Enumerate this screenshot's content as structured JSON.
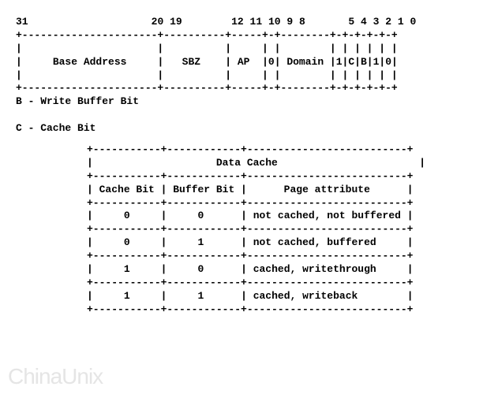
{
  "bitlabels": {
    "b31": "31",
    "b20": "20",
    "b19": "19",
    "b12": "12",
    "b11": "11",
    "b10": "10",
    "b9": "9",
    "b8": "8",
    "b5": "5",
    "b4": "4",
    "b3": "3",
    "b2": "2",
    "b1": "1",
    "b0": "0"
  },
  "fields": {
    "base": "Base Address",
    "sbz": "SBZ",
    "ap": "AP",
    "zero9": "0",
    "domain": "Domain",
    "b4v": "1",
    "c": "C",
    "b": "B",
    "b1v": "1",
    "b0v": "0"
  },
  "legend": {
    "b": "B - Write Buffer Bit",
    "c": "C - Cache Bit"
  },
  "table": {
    "title": "Data Cache",
    "h1": "Cache Bit",
    "h2": "Buffer Bit",
    "h3": "Page attribute",
    "rows": [
      {
        "c": "0",
        "b": "0",
        "a": "not cached, not buffered"
      },
      {
        "c": "0",
        "b": "1",
        "a": "not cached, buffered"
      },
      {
        "c": "1",
        "b": "0",
        "a": "cached, writethrough"
      },
      {
        "c": "1",
        "b": "1",
        "a": "cached, writeback"
      }
    ]
  },
  "watermark": "ChinaUnix"
}
